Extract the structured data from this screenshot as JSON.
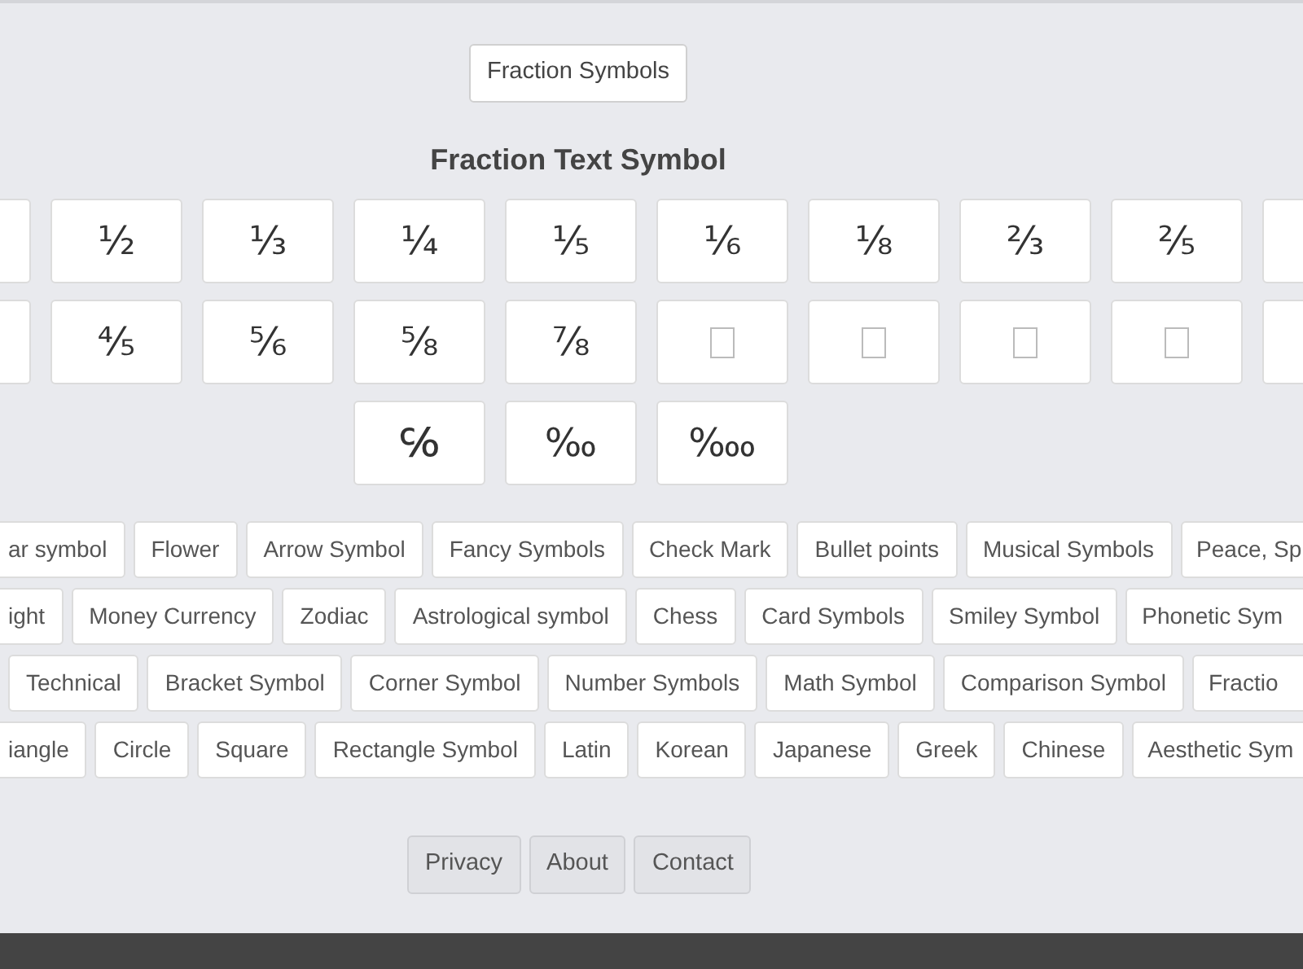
{
  "top_button": "Fraction Symbols",
  "title": "Fraction Text Symbol",
  "symbol_rows": [
    [
      {
        "kind": "clipped"
      },
      {
        "kind": "glyph",
        "text": "½"
      },
      {
        "kind": "glyph",
        "text": "⅓"
      },
      {
        "kind": "glyph",
        "text": "¼"
      },
      {
        "kind": "glyph",
        "text": "⅕"
      },
      {
        "kind": "glyph",
        "text": "⅙"
      },
      {
        "kind": "glyph",
        "text": "⅛"
      },
      {
        "kind": "glyph",
        "text": "⅔"
      },
      {
        "kind": "glyph",
        "text": "⅖"
      },
      {
        "kind": "clipped"
      }
    ],
    [
      {
        "kind": "clipped"
      },
      {
        "kind": "glyph",
        "text": "⅘"
      },
      {
        "kind": "glyph",
        "text": "⅚"
      },
      {
        "kind": "glyph",
        "text": "⅝"
      },
      {
        "kind": "glyph",
        "text": "⅞"
      },
      {
        "kind": "missing"
      },
      {
        "kind": "missing"
      },
      {
        "kind": "missing"
      },
      {
        "kind": "missing"
      },
      {
        "kind": "clipped"
      }
    ],
    [
      {
        "kind": "spacer"
      },
      {
        "kind": "spacer"
      },
      {
        "kind": "spacer"
      },
      {
        "kind": "glyph",
        "text": "℅"
      },
      {
        "kind": "glyph",
        "text": "‰"
      },
      {
        "kind": "glyph",
        "text": "‱"
      }
    ]
  ],
  "category_rows": [
    [
      {
        "kind": "tag",
        "label": "ar symbol"
      },
      {
        "kind": "tag",
        "label": "Flower"
      },
      {
        "kind": "tag",
        "label": "Arrow Symbol"
      },
      {
        "kind": "tag",
        "label": "Fancy Symbols"
      },
      {
        "kind": "tag",
        "label": "Check Mark"
      },
      {
        "kind": "tag",
        "label": "Bullet points"
      },
      {
        "kind": "tag",
        "label": "Musical Symbols"
      },
      {
        "kind": "tag",
        "label": "Peace, Sp"
      }
    ],
    [
      {
        "kind": "tag",
        "label": "ight"
      },
      {
        "kind": "tag",
        "label": "Money Currency"
      },
      {
        "kind": "tag",
        "label": "Zodiac"
      },
      {
        "kind": "tag",
        "label": "Astrological symbol"
      },
      {
        "kind": "tag",
        "label": "Chess"
      },
      {
        "kind": "tag",
        "label": "Card Symbols"
      },
      {
        "kind": "tag",
        "label": "Smiley Symbol"
      },
      {
        "kind": "tag",
        "label": "Phonetic Sym"
      }
    ],
    [
      {
        "kind": "clipped"
      },
      {
        "kind": "tag",
        "label": "Technical"
      },
      {
        "kind": "tag",
        "label": "Bracket Symbol"
      },
      {
        "kind": "tag",
        "label": "Corner Symbol"
      },
      {
        "kind": "tag",
        "label": "Number Symbols"
      },
      {
        "kind": "tag",
        "label": "Math Symbol"
      },
      {
        "kind": "tag",
        "label": "Comparison Symbol"
      },
      {
        "kind": "tag",
        "label": "Fractio"
      }
    ],
    [
      {
        "kind": "tag",
        "label": "iangle"
      },
      {
        "kind": "tag",
        "label": "Circle"
      },
      {
        "kind": "tag",
        "label": "Square"
      },
      {
        "kind": "tag",
        "label": "Rectangle Symbol"
      },
      {
        "kind": "tag",
        "label": "Latin"
      },
      {
        "kind": "tag",
        "label": "Korean"
      },
      {
        "kind": "tag",
        "label": "Japanese"
      },
      {
        "kind": "tag",
        "label": "Greek"
      },
      {
        "kind": "tag",
        "label": "Chinese"
      },
      {
        "kind": "tag",
        "label": "Aesthetic Sym"
      }
    ]
  ],
  "footer_links": [
    "Privacy",
    "About",
    "Contact"
  ]
}
